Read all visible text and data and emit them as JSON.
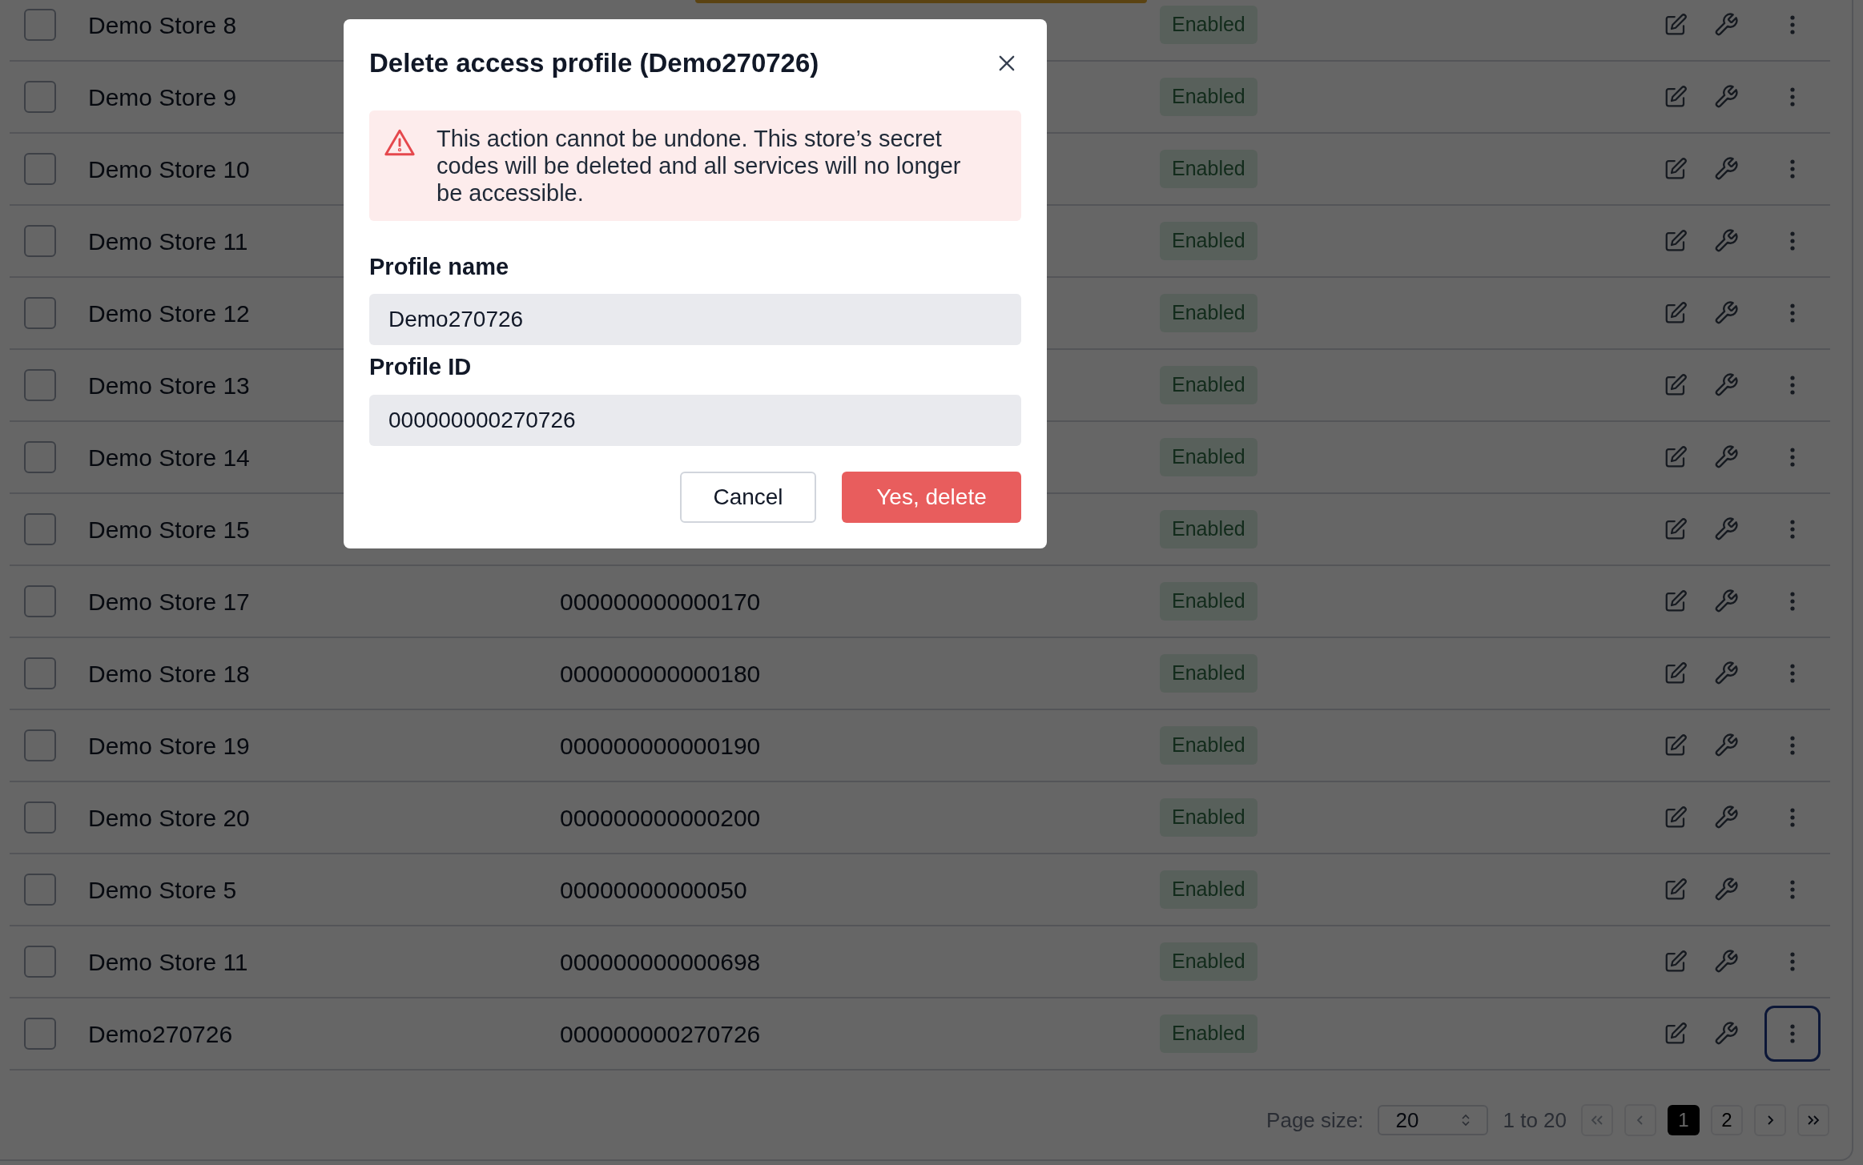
{
  "rows": [
    {
      "name": "Demo Store 8",
      "id": "",
      "status": "Enabled",
      "checked": false,
      "menu_focused": false
    },
    {
      "name": "Demo Store 9",
      "id": "",
      "status": "Enabled",
      "checked": false,
      "menu_focused": false
    },
    {
      "name": "Demo Store 10",
      "id": "",
      "status": "Enabled",
      "checked": false,
      "menu_focused": false
    },
    {
      "name": "Demo Store 11",
      "id": "",
      "status": "Enabled",
      "checked": false,
      "menu_focused": false
    },
    {
      "name": "Demo Store 12",
      "id": "",
      "status": "Enabled",
      "checked": false,
      "menu_focused": false
    },
    {
      "name": "Demo Store 13",
      "id": "",
      "status": "Enabled",
      "checked": false,
      "menu_focused": false
    },
    {
      "name": "Demo Store 14",
      "id": "",
      "status": "Enabled",
      "checked": false,
      "menu_focused": false
    },
    {
      "name": "Demo Store 15",
      "id": "",
      "status": "Enabled",
      "checked": false,
      "menu_focused": false
    },
    {
      "name": "Demo Store 17",
      "id": "000000000000170",
      "status": "Enabled",
      "checked": false,
      "menu_focused": false
    },
    {
      "name": "Demo Store 18",
      "id": "000000000000180",
      "status": "Enabled",
      "checked": false,
      "menu_focused": false
    },
    {
      "name": "Demo Store 19",
      "id": "000000000000190",
      "status": "Enabled",
      "checked": false,
      "menu_focused": false
    },
    {
      "name": "Demo Store 20",
      "id": "000000000000200",
      "status": "Enabled",
      "checked": false,
      "menu_focused": false
    },
    {
      "name": "Demo Store 5",
      "id": "00000000000050",
      "status": "Enabled",
      "checked": false,
      "menu_focused": false
    },
    {
      "name": "Demo Store 11",
      "id": "000000000000698",
      "status": "Enabled",
      "checked": false,
      "menu_focused": false
    },
    {
      "name": "Demo270726",
      "id": "000000000270726",
      "status": "Enabled",
      "checked": false,
      "menu_focused": true
    }
  ],
  "pagination": {
    "page_size_label": "Page size:",
    "page_size": "20",
    "range": "1 to 20",
    "first_disabled": true,
    "prev_disabled": true,
    "next_disabled": false,
    "last_disabled": false,
    "pages": [
      {
        "label": "1",
        "selected": true
      },
      {
        "label": "2",
        "selected": false
      }
    ]
  },
  "dialog": {
    "title": "Delete access profile (Demo270726)",
    "warning": "This action cannot be undone. This store’s secret codes will be deleted and all services will no longer be accessible.",
    "fields": [
      {
        "label": "Profile name",
        "value": "Demo270726"
      },
      {
        "label": "Profile ID",
        "value": "000000000270726"
      }
    ],
    "cancel": "Cancel",
    "confirm": "Yes, delete"
  }
}
